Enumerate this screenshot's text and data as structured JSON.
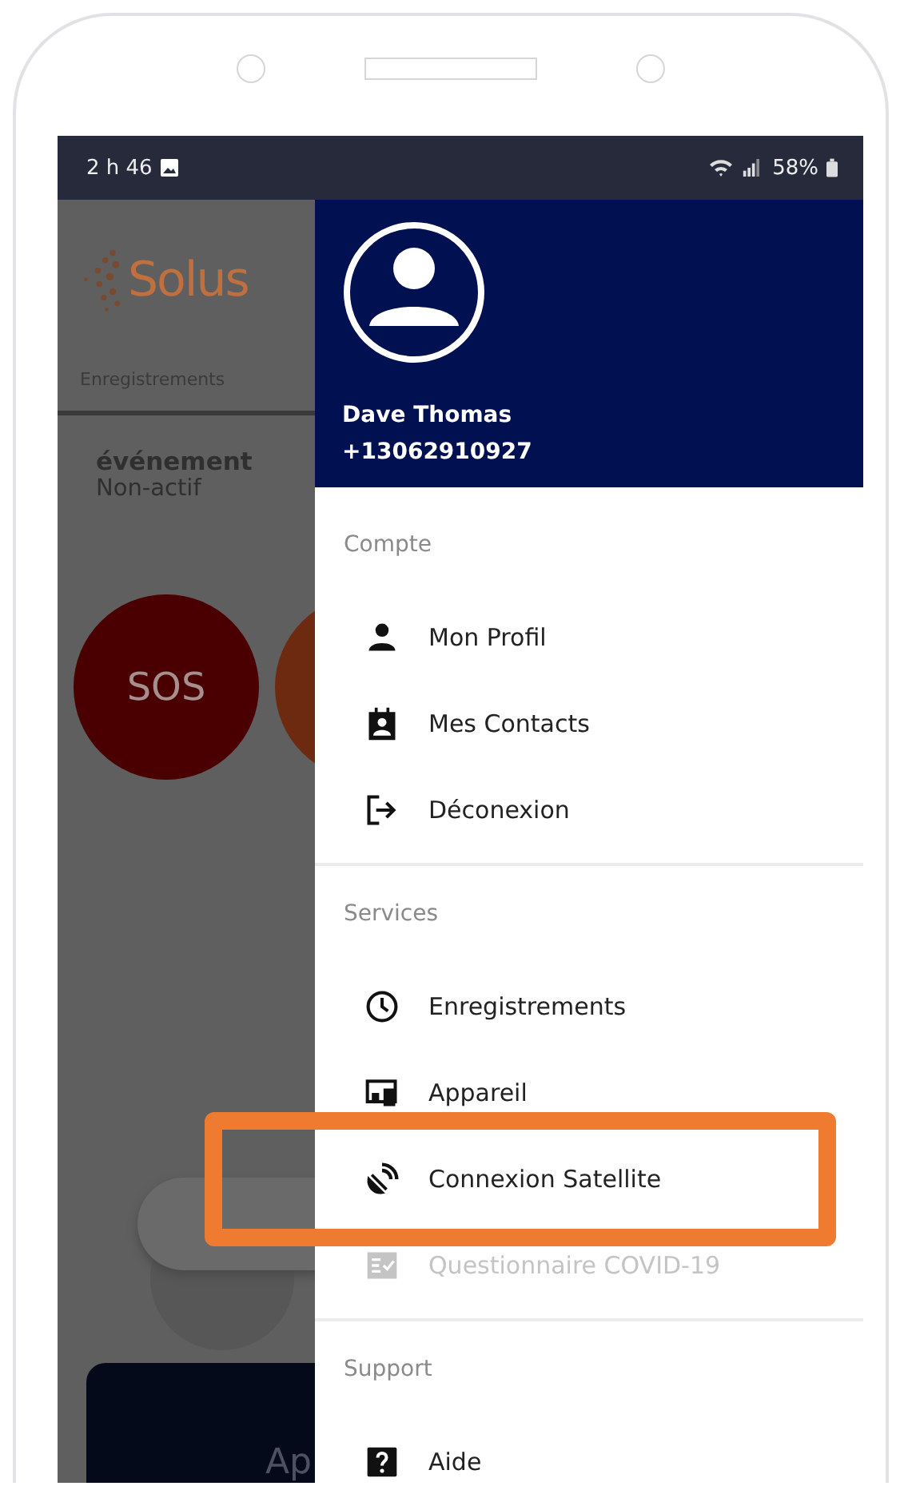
{
  "status_bar": {
    "time": "2 h 46",
    "battery": "58%"
  },
  "background_app": {
    "logo": "Solus",
    "tab": "Enregistrements",
    "event_title": "événement",
    "event_status": "Non-actif",
    "sos_button": "SOS",
    "bottom_button": "Ap"
  },
  "drawer": {
    "user_name": "Dave Thomas",
    "phone": "+13062910927",
    "sections": [
      {
        "title": "Compte",
        "items": [
          {
            "label": "Mon Profil",
            "kind": "person",
            "disabled": false,
            "highlighted": false
          },
          {
            "label": "Mes Contacts",
            "kind": "contacts",
            "disabled": false,
            "highlighted": false
          },
          {
            "label": "Déconexion",
            "kind": "logout",
            "disabled": false,
            "highlighted": false
          }
        ]
      },
      {
        "title": "Services",
        "items": [
          {
            "label": "Enregistrements",
            "kind": "clock",
            "disabled": false,
            "highlighted": false
          },
          {
            "label": "Appareil",
            "kind": "device",
            "disabled": false,
            "highlighted": false
          },
          {
            "label": "Connexion Satellite",
            "kind": "satellite",
            "disabled": false,
            "highlighted": true
          },
          {
            "label": "Questionnaire COVID-19",
            "kind": "checklist",
            "disabled": true,
            "highlighted": false
          }
        ]
      },
      {
        "title": "Support",
        "items": [
          {
            "label": "Aide",
            "kind": "help",
            "disabled": false,
            "highlighted": false
          }
        ]
      }
    ]
  }
}
